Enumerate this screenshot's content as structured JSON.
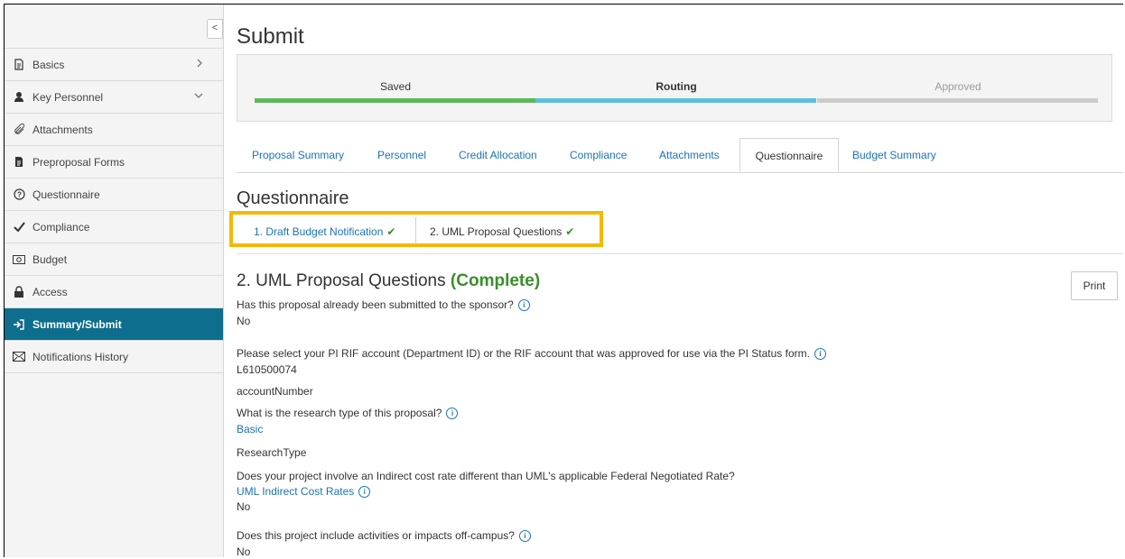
{
  "sidebar": {
    "items": [
      {
        "label": "Basics",
        "caret": ">"
      },
      {
        "label": "Key Personnel",
        "caret": "v"
      },
      {
        "label": "Attachments",
        "caret": ""
      },
      {
        "label": "Preproposal Forms",
        "caret": ""
      },
      {
        "label": "Questionnaire",
        "caret": ""
      },
      {
        "label": "Compliance",
        "caret": ""
      },
      {
        "label": "Budget",
        "caret": ""
      },
      {
        "label": "Access",
        "caret": ""
      },
      {
        "label": "Summary/Submit",
        "caret": ""
      },
      {
        "label": "Notifications History",
        "caret": ""
      }
    ],
    "collapse_glyph": "<"
  },
  "page": {
    "title": "Submit"
  },
  "progress": {
    "stages": [
      {
        "label": "Saved",
        "color": "#5cb85c"
      },
      {
        "label": "Routing",
        "color": "#5bc0de"
      },
      {
        "label": "Approved",
        "color": "#cccccc"
      }
    ]
  },
  "tabs": [
    "Proposal Summary",
    "Personnel",
    "Credit Allocation",
    "Compliance",
    "Attachments",
    "Questionnaire",
    "Budget Summary"
  ],
  "section": {
    "title": "Questionnaire"
  },
  "subtabs": [
    {
      "label": "1. Draft Budget Notification",
      "check": "✔"
    },
    {
      "label": "2. UML Proposal Questions",
      "check": "✔"
    }
  ],
  "questionnaire": {
    "title": "2. UML Proposal Questions",
    "status": "(Complete)",
    "print_label": "Print",
    "q1": {
      "question": "Has this proposal already been submitted to the sponsor?",
      "answer": "No"
    },
    "q2": {
      "question": "Please select your PI RIF account (Department ID) or the RIF account that was approved for use via the PI Status form.",
      "answer": "L610500074",
      "field": "accountNumber"
    },
    "q3": {
      "question": "What is the research type of this proposal?",
      "answer": "Basic",
      "field": "ResearchType"
    },
    "q4": {
      "question": "Does your project involve an Indirect cost rate different than UML's applicable Federal Negotiated Rate?",
      "link": "UML Indirect Cost Rates",
      "answer": "No"
    },
    "q5": {
      "question": "Does this project include activities or impacts off-campus?",
      "answer": "No"
    }
  },
  "colors": {
    "accent": "#0e6e8e",
    "link": "#1a73b8",
    "complete": "#3a8f2a",
    "highlight": "#f5b800"
  }
}
